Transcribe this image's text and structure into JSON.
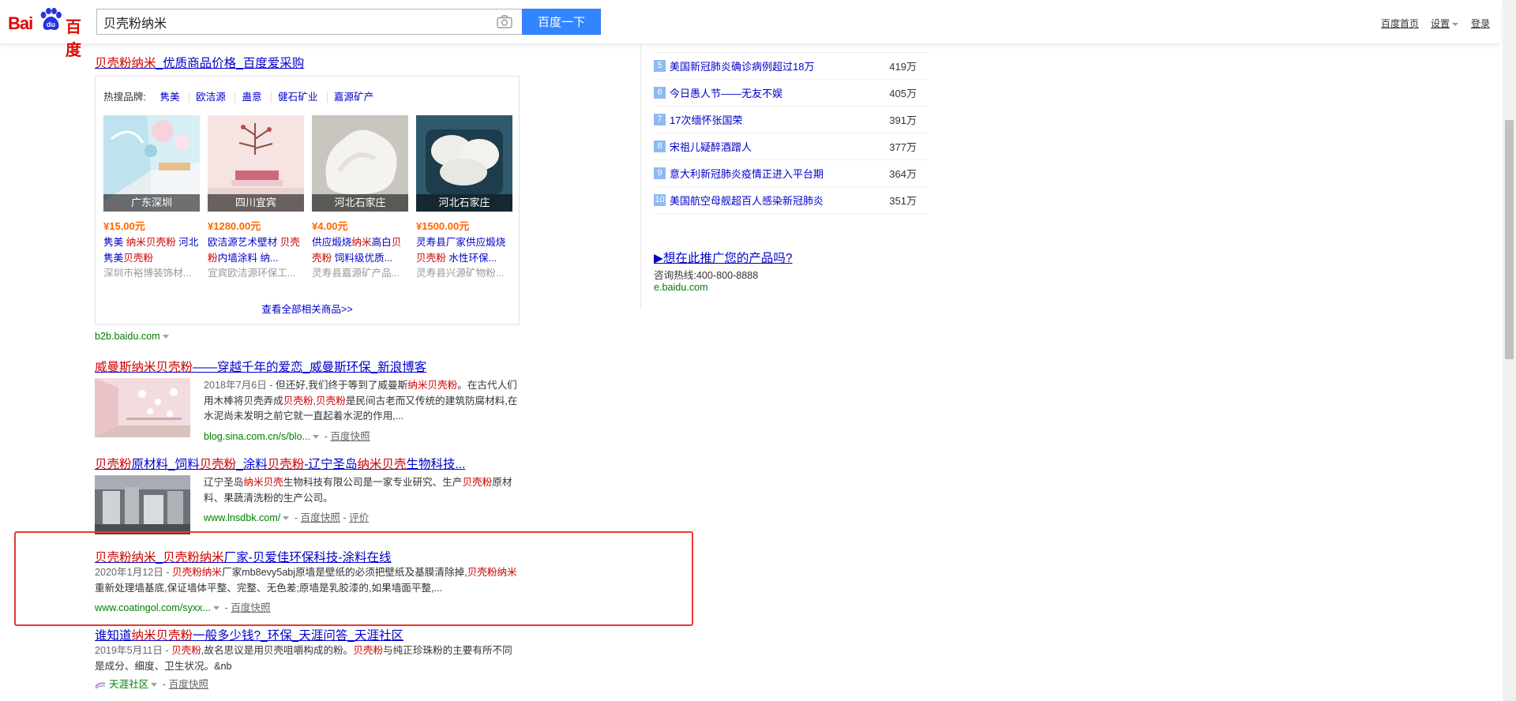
{
  "header": {
    "logo_text_left": "Bai",
    "logo_text_right": "百度",
    "logo_paw_text": "du",
    "search_value": "贝壳粉纳米",
    "search_button": "百度一下",
    "links": {
      "home": "百度首页",
      "settings": "设置",
      "login": "登录"
    }
  },
  "shopping": {
    "title_hl": "贝壳粉纳米",
    "title_rest": "_优质商品价格_百度爱采购",
    "hot_label": "热搜品牌:",
    "brands": [
      "隽美",
      "欧洁源",
      "蛊意",
      "健石矿业",
      "嘉源矿产"
    ],
    "products": [
      {
        "location": "广东深圳",
        "price": "¥15.00元",
        "name_a": "隽美 ",
        "name_hl1": "纳米贝壳粉",
        "name_b": " 河北隽美",
        "name_hl2": "贝壳粉",
        "name_c": "",
        "seller": "深圳市裕博装饰材..."
      },
      {
        "location": "四川宜宾",
        "price": "¥1280.00元",
        "name_a": "欧洁源艺术壁材 ",
        "name_hl1": "贝壳粉",
        "name_b": "内墙涂料 纳...",
        "name_hl2": "",
        "name_c": "",
        "seller": "宜宾欧洁源环保工..."
      },
      {
        "location": "河北石家庄",
        "price": "¥4.00元",
        "name_a": "供应煅烧",
        "name_hl1": "纳米",
        "name_b": "高白",
        "name_hl2": "贝壳粉",
        "name_c": " 饲料级优质...",
        "seller": "灵寿县嘉源矿产品..."
      },
      {
        "location": "河北石家庄",
        "price": "¥1500.00元",
        "name_a": "灵寿县厂家供应煅烧",
        "name_hl1": "贝壳粉",
        "name_b": " 水性环保...",
        "name_hl2": "",
        "name_c": "",
        "seller": "灵寿县兴源矿物粉..."
      }
    ],
    "see_all": "查看全部相关商品>>",
    "url": "b2b.baidu.com"
  },
  "results": [
    {
      "title_hl1": "威曼斯纳米贝壳粉",
      "title_rest": "——穿越千年的爱恋_威曼斯环保_新浪博客",
      "snippet_date": "2018年7月6日 - ",
      "snippet_a": "但还好,我们终于等到了威曼斯",
      "snippet_hl1": "纳米贝壳粉",
      "snippet_b": "。在古代人们用木棒将贝壳弄成",
      "snippet_hl2": "贝壳粉",
      "snippet_c": ",",
      "snippet_hl3": "贝壳粉",
      "snippet_d": "是民间古老而又传统的建筑防腐材料,在水泥尚未发明之前它就一直起着水泥的作用,...",
      "url": "blog.sina.com.cn/s/blo...",
      "kuaizhao": "百度快照"
    },
    {
      "title_hl1": "贝壳粉",
      "title_b": "原材料_饲料",
      "title_hl2": "贝壳粉",
      "title_c": "_涂料",
      "title_hl3": "贝壳粉",
      "title_d": "-辽宁圣岛",
      "title_hl4": "纳米贝壳",
      "title_e": "生物科技...",
      "snippet_a": "辽宁圣岛",
      "snippet_hl1": "纳米贝壳",
      "snippet_b": "生物科技有限公司是一家专业研究、生产",
      "snippet_hl2": "贝壳粉",
      "snippet_c": "原材料、果蔬清洗粉的生产公司。",
      "url": "www.lnsdbk.com/",
      "kuaizhao": "百度快照",
      "pingjia": "评价"
    },
    {
      "title_hl1": "贝壳粉纳米",
      "title_b": "_",
      "title_hl2": "贝壳粉纳米",
      "title_c": "厂家-贝爱佳环保科技-涂料在线",
      "snippet_date": "2020年1月12日 - ",
      "snippet_hl1": "贝壳粉纳米",
      "snippet_a": "厂家mb8evy5abj原墙是壁纸的必须把壁纸及基膜清除掉,",
      "snippet_hl2": "贝壳粉纳米",
      "snippet_b": "重新处理墙基底,保证墙体平整、完整、无色差;原墙是乳胶漆的,如果墙面平整,...",
      "url": "www.coatingol.com/syxx...",
      "kuaizhao": "百度快照"
    },
    {
      "title_a": "谁知道",
      "title_hl1": "纳米贝壳粉",
      "title_b": "一般多少钱?_环保_天涯问答_天涯社区",
      "snippet_date": "2019年5月11日 - ",
      "snippet_hl1": "贝壳粉",
      "snippet_a": ",故名思议是用贝壳咀嚼构成的粉。",
      "snippet_hl2": "贝壳粉",
      "snippet_b": "与纯正珍珠粉的主要有所不同是成分、细度、卫生状况。&nb",
      "url": "天涯社区",
      "kuaizhao": "百度快照"
    }
  ],
  "ranking": [
    {
      "num": "5",
      "title": "美国新冠肺炎确诊病例超过18万",
      "count": "419万"
    },
    {
      "num": "6",
      "title": "今日愚人节——无友不娱",
      "count": "405万"
    },
    {
      "num": "7",
      "title": "17次缅怀张国荣",
      "count": "391万"
    },
    {
      "num": "8",
      "title": "宋祖儿疑醉酒蹭人",
      "count": "377万"
    },
    {
      "num": "9",
      "title": "意大利新冠肺炎疫情正进入平台期",
      "count": "364万"
    },
    {
      "num": "10",
      "title": "美国航空母舰超百人感染新冠肺炎",
      "count": "351万"
    }
  ],
  "promo": {
    "title": "▶想在此推广您的产品吗?",
    "hotline": "咨询热线:400-800-8888",
    "url": "e.baidu.com"
  },
  "colors": {
    "accent": "#3385ff",
    "highlight_red": "#c00",
    "link_blue": "#00c",
    "url_green": "#008000",
    "annotation_box": "#e53a2f"
  }
}
